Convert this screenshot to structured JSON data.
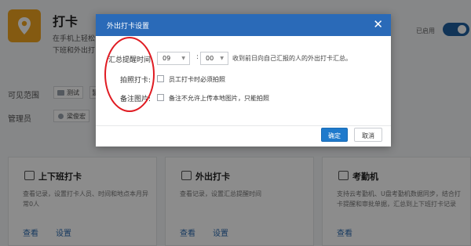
{
  "app": {
    "title": "打卡",
    "desc_line1": "在手机上轻松",
    "desc_line2": "下班和外出打",
    "enabled_label": "已启用",
    "icon": "location-pin-icon",
    "icon_color": "#f0a41f"
  },
  "visibility": {
    "label": "可见范围",
    "tag1": "测试",
    "tag2": "慧"
  },
  "admin": {
    "label": "管理员",
    "tag1": "梁俊宏"
  },
  "cards": [
    {
      "title": "上下班打卡",
      "desc": "查看记录，设置打卡人员、时间和地点本月异常0人",
      "link1": "查看",
      "link2": "设置",
      "icon": "clipboard-icon"
    },
    {
      "title": "外出打卡",
      "desc": "查看记录，设置汇总提醒时间",
      "link1": "查看",
      "link2": "设置",
      "icon": "camera-icon"
    },
    {
      "title": "考勤机",
      "desc": "支持云考勤机、U盘考勤机数据同步，结合打卡提醒和审批单据，汇总到上下班打卡记录",
      "link1": "查看",
      "icon": "attendance-machine-icon"
    }
  ],
  "dialog": {
    "title": "外出打卡设置",
    "close_icon": "close-icon",
    "summary_label": "汇总提醒时间",
    "hour_value": "09",
    "minute_value": "00",
    "time_separator": ":",
    "summary_hint": "收到前日向自己汇报的人的外出打卡汇总。",
    "photo_label": "拍照打卡:",
    "photo_option": "员工打卡时必须拍照",
    "photo_checked": false,
    "note_label": "备注图片:",
    "note_option": "备注不允许上传本地图片，只能拍照",
    "note_checked": false,
    "ok_label": "确定",
    "cancel_label": "取消",
    "header_color": "#2a6ab8",
    "ok_color": "#1f7acc"
  },
  "annotation": {
    "ellipse_color": "#e01b22"
  }
}
